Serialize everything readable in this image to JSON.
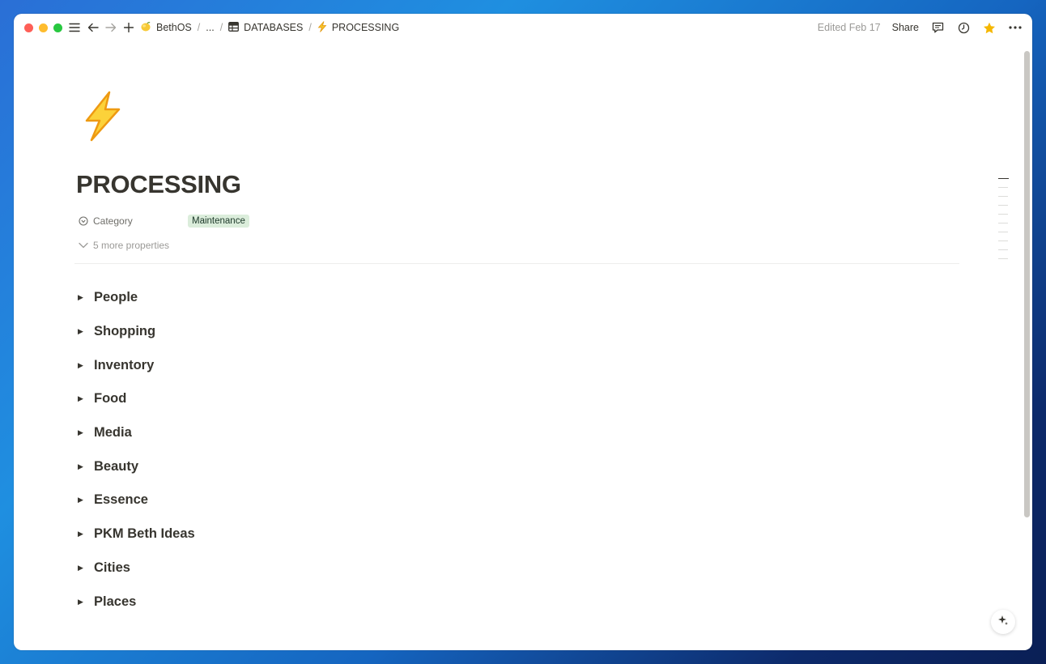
{
  "topbar": {
    "breadcrumbs": [
      {
        "label": "BethOS",
        "icon": "lemon-emoji-icon"
      },
      {
        "label": "..."
      },
      {
        "label": "DATABASES",
        "icon": "table-icon"
      },
      {
        "label": "PROCESSING",
        "icon": "lightning-emoji-icon"
      }
    ],
    "edited": "Edited Feb 17",
    "share_label": "Share"
  },
  "page": {
    "title": "PROCESSING",
    "icon": "lightning-emoji-icon",
    "properties": [
      {
        "label": "Category",
        "value": "Maintenance",
        "value_color": "#dbeddb"
      }
    ],
    "more_properties_label": "5 more properties",
    "toggles": [
      "People",
      "Shopping",
      "Inventory",
      "Food",
      "Media",
      "Beauty",
      "Essence",
      "PKM Beth Ideas",
      "Cities",
      "Places"
    ]
  },
  "colors": {
    "accent_star": "#f5b700",
    "tag_bg": "#dbeddb"
  }
}
